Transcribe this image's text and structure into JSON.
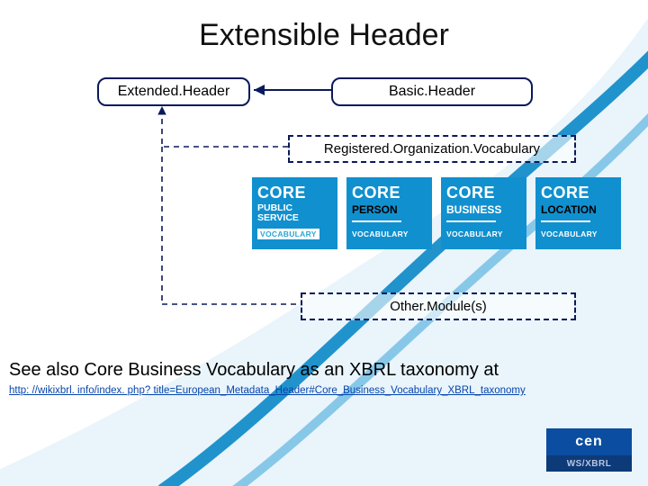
{
  "title": "Extensible Header",
  "boxes": {
    "extended": "Extended.Header",
    "basic": "Basic.Header",
    "regorg": "Registered.Organization.Vocabulary",
    "other": "Other.Module(s)"
  },
  "cores": [
    {
      "top": "CORE",
      "mid": "PUBLIC SERVICE",
      "bot": "VOCABULARY",
      "mid_black": false
    },
    {
      "top": "CORE",
      "mid": "PERSON",
      "bot": "VOCABULARY",
      "mid_black": true
    },
    {
      "top": "CORE",
      "mid": "BUSINESS",
      "bot": "VOCABULARY",
      "mid_black": false
    },
    {
      "top": "CORE",
      "mid": "LOCATION",
      "bot": "VOCABULARY",
      "mid_black": true
    }
  ],
  "see_also": "See also Core Business Vocabulary as an XBRL taxonomy at",
  "link": "http: //wikixbrl. info/index. php? title=European_Metadata_Header#Core_Business_Vocabulary_XBRL_taxonomy",
  "logo": {
    "top": "cen",
    "bottom": "WS/XBRL"
  }
}
